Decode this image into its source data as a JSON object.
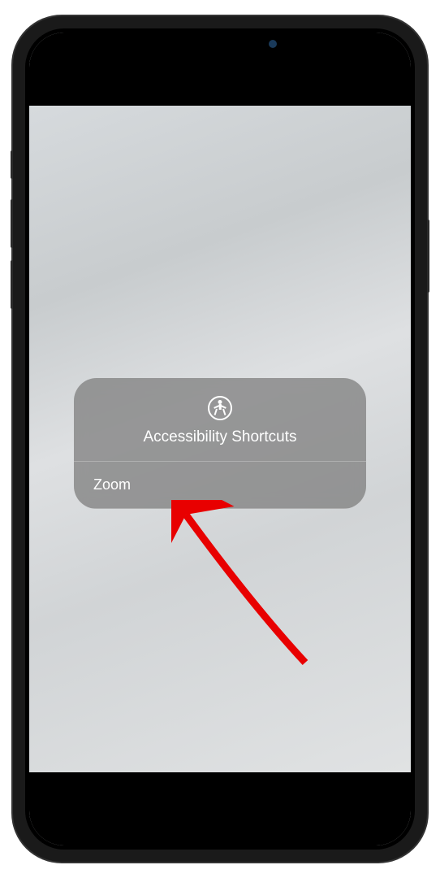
{
  "popup": {
    "title": "Accessibility Shortcuts",
    "items": [
      {
        "label": "Zoom"
      }
    ]
  }
}
